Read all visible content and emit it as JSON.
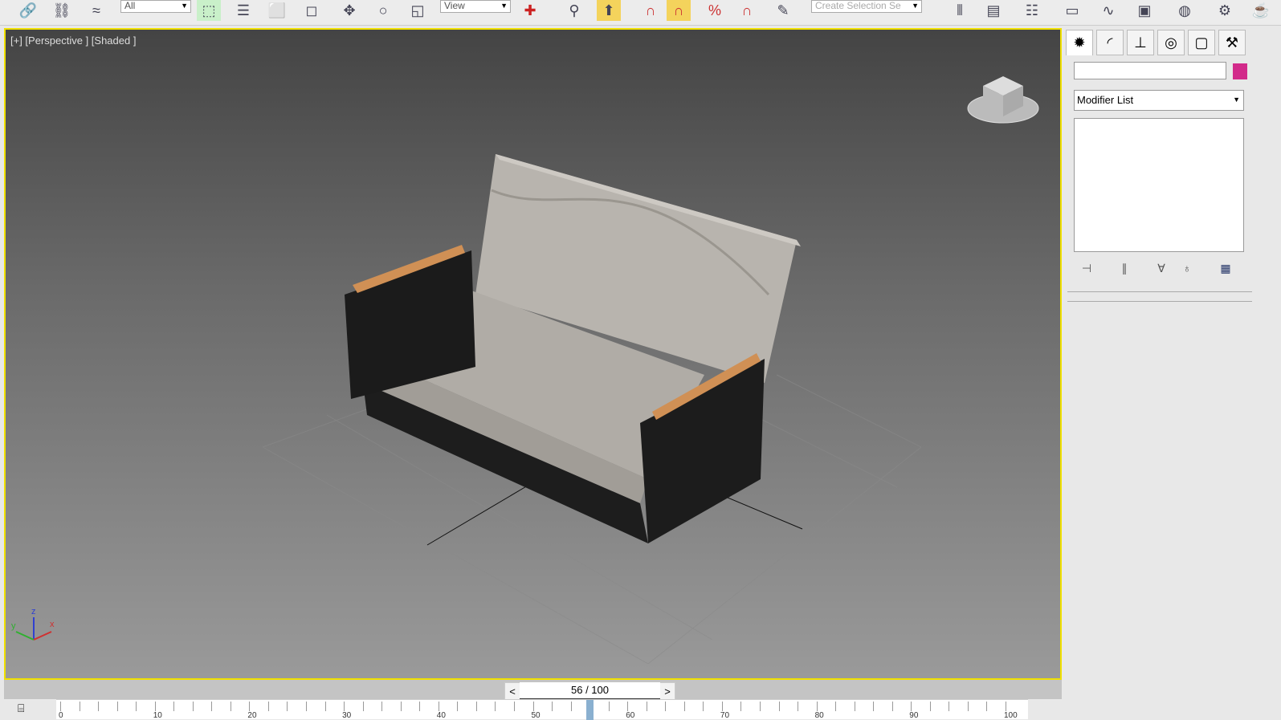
{
  "toolbar": {
    "selection_filter": "All",
    "reference_coord": "View",
    "named_selection_placeholder": "Create Selection Se",
    "colors": {
      "active": "#f4d35c",
      "selected": "#c9f0c9"
    }
  },
  "viewport": {
    "label": "[+] [Perspective ] [Shaded ]",
    "border_color": "#f0e000",
    "axis_labels": {
      "x": "x",
      "y": "y",
      "z": "z"
    }
  },
  "command_panel": {
    "object_name": "",
    "object_color": "#d22a8a",
    "modifier_list": "Modifier List"
  },
  "time_slider": {
    "prev": "<",
    "next": ">",
    "label": "56 / 100",
    "current_frame": 56,
    "total_frames": 100,
    "tick_labels": [
      "0",
      "10",
      "20",
      "30",
      "40",
      "50",
      "60",
      "70",
      "80",
      "90",
      "100"
    ]
  }
}
